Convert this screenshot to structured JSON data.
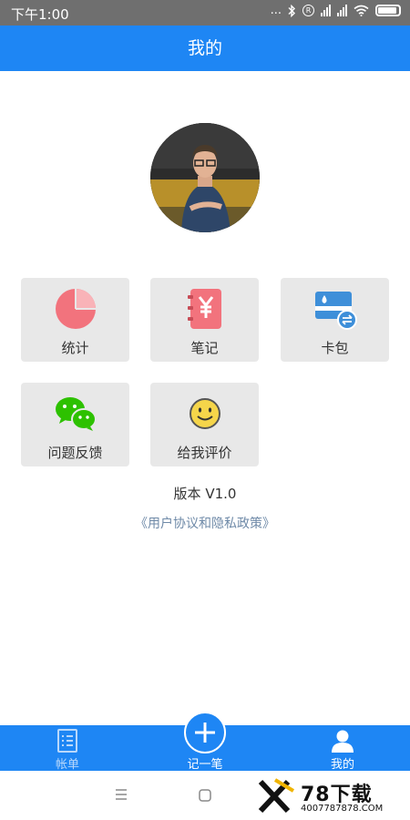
{
  "status_bar": {
    "time": "下午1:00",
    "dots": "...",
    "r_badge": "R"
  },
  "header": {
    "title": "我的"
  },
  "grid": [
    {
      "label": "统计",
      "icon": "pie-chart-icon",
      "color": "#f2737d"
    },
    {
      "label": "笔记",
      "icon": "notebook-yen-icon",
      "color": "#f2737d"
    },
    {
      "label": "卡包",
      "icon": "card-wallet-icon",
      "color": "#3e8fd9"
    },
    {
      "label": "问题反馈",
      "icon": "wechat-icon",
      "color": "#2dc100"
    },
    {
      "label": "给我评价",
      "icon": "smiley-icon",
      "color": "#f5d54a"
    }
  ],
  "version_text": "版本 V1.0",
  "agreement_link": "《用户协议和隐私政策》",
  "bottom_nav": {
    "bill": "帐单",
    "add": "记一笔",
    "mine": "我的"
  },
  "watermark": {
    "brand": "78下载",
    "url": "4007787878.COM"
  },
  "colors": {
    "primary": "#1e86f4",
    "tile_bg": "#e8e8e8"
  }
}
